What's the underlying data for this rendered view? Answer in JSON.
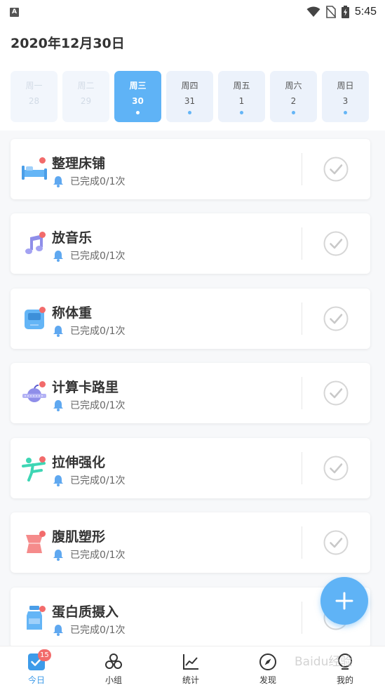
{
  "status_bar": {
    "time": "5:45",
    "app_letter": "A"
  },
  "header": {
    "date": "2020年12月30日"
  },
  "week": [
    {
      "name": "周一",
      "num": "28",
      "state": "past"
    },
    {
      "name": "周二",
      "num": "29",
      "state": "past"
    },
    {
      "name": "周三",
      "num": "30",
      "state": "today"
    },
    {
      "name": "周四",
      "num": "31",
      "state": "future"
    },
    {
      "name": "周五",
      "num": "1",
      "state": "future"
    },
    {
      "name": "周六",
      "num": "2",
      "state": "future"
    },
    {
      "name": "周日",
      "num": "3",
      "state": "future"
    }
  ],
  "tasks": [
    {
      "title": "整理床铺",
      "progress": "已完成0/1次",
      "icon": "bed-icon"
    },
    {
      "title": "放音乐",
      "progress": "已完成0/1次",
      "icon": "music-note-icon"
    },
    {
      "title": "称体重",
      "progress": "已完成0/1次",
      "icon": "scale-icon"
    },
    {
      "title": "计算卡路里",
      "progress": "已完成0/1次",
      "icon": "apple-scale-icon"
    },
    {
      "title": "拉伸强化",
      "progress": "已完成0/1次",
      "icon": "stretch-person-icon"
    },
    {
      "title": "腹肌塑形",
      "progress": "已完成0/1次",
      "icon": "torso-icon"
    },
    {
      "title": "蛋白质摄入",
      "progress": "已完成0/1次",
      "icon": "protein-bottle-icon"
    }
  ],
  "tabs": [
    {
      "label": "今日",
      "icon": "today-check-icon",
      "badge": "15",
      "active": true
    },
    {
      "label": "小组",
      "icon": "group-icon",
      "active": false
    },
    {
      "label": "统计",
      "icon": "stats-chart-icon",
      "active": false
    },
    {
      "label": "发现",
      "icon": "compass-icon",
      "active": false
    },
    {
      "label": "我的",
      "icon": "profile-icon",
      "active": false
    }
  ],
  "watermark": "Baidu经验",
  "colors": {
    "accent": "#5fb3f6",
    "dot": "#f26b6b",
    "active_tab": "#3d9be9"
  }
}
